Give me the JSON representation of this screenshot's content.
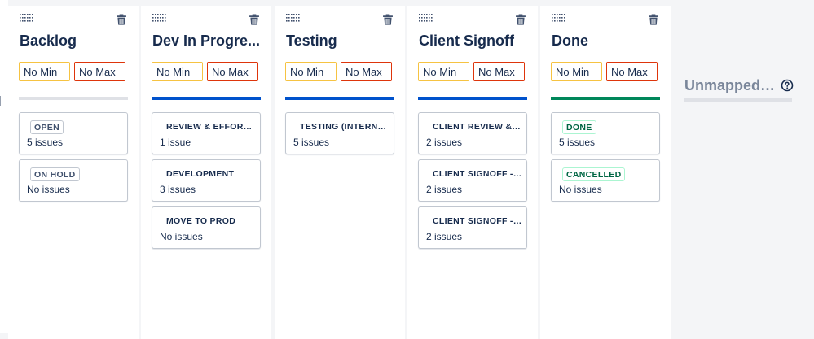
{
  "colors": {
    "todo_bar": "#dfe1e6",
    "inprogress_bar": "#0052cc",
    "done_bar": "#00875a",
    "min_border": "#f6c342",
    "max_border": "#de350b"
  },
  "icons": {
    "drag": "drag-handle-icon",
    "delete": "trash-icon",
    "help": "question-circle-icon"
  },
  "columns": [
    {
      "title": "Backlog",
      "min": "No Min",
      "max": "No Max",
      "category": "todo",
      "statuses": [
        {
          "name": "OPEN",
          "count": "5 issues"
        },
        {
          "name": "ON HOLD",
          "count": "No issues"
        }
      ]
    },
    {
      "title": "Dev In Progre...",
      "min": "No Min",
      "max": "No Max",
      "category": "inprogress",
      "statuses": [
        {
          "name": "REVIEW & EFFORT E...",
          "count": "1 issue"
        },
        {
          "name": "DEVELOPMENT",
          "count": "3 issues"
        },
        {
          "name": "MOVE TO PROD",
          "count": "No issues"
        }
      ]
    },
    {
      "title": "Testing",
      "min": "No Min",
      "max": "No Max",
      "category": "inprogress",
      "statuses": [
        {
          "name": "TESTING (INTERNAL)",
          "count": "5 issues"
        }
      ]
    },
    {
      "title": "Client Signoff",
      "min": "No Min",
      "max": "No Max",
      "category": "inprogress",
      "statuses": [
        {
          "name": "CLIENT REVIEW & A...",
          "count": "2 issues"
        },
        {
          "name": "CLIENT SIGNOFF - U...",
          "count": "2 issues"
        },
        {
          "name": "CLIENT SIGNOFF - P...",
          "count": "2 issues"
        }
      ]
    },
    {
      "title": "Done",
      "min": "No Min",
      "max": "No Max",
      "category": "done",
      "statuses": [
        {
          "name": "DONE",
          "count": "5 issues"
        },
        {
          "name": "CANCELLED",
          "count": "No issues"
        }
      ]
    }
  ],
  "unmapped": {
    "title": "Unmapped S..."
  }
}
